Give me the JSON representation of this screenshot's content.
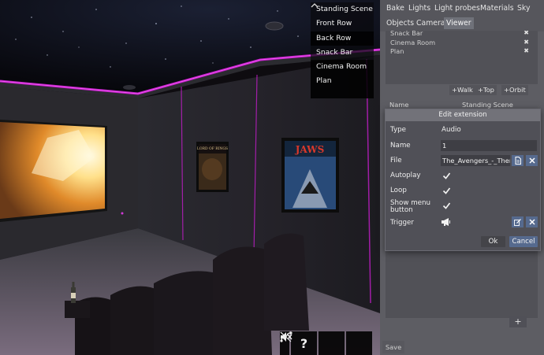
{
  "scene": {
    "camera_menu": [
      "Standing Scene",
      "Front Row",
      "Back Row",
      "Snack Bar",
      "Cinema Room",
      "Plan"
    ],
    "collapse_icon": "chevron-up-icon",
    "posters": [
      "THE LORD OF THE RINGS",
      "JAWS"
    ],
    "toolbar": {
      "expand_icon": "chevron-right-icon",
      "help_label": "?",
      "mute_icon": "speaker-muted-icon",
      "path_icon": "curve-path-icon"
    },
    "accent_color": "#c21ec9"
  },
  "panel": {
    "tabs": [
      "Bake",
      "Lights",
      "Light probes",
      "Materials",
      "Sky",
      "Objects",
      "Camera",
      "Viewer"
    ],
    "active_tab": "Viewer",
    "list_items": [
      "Snack Bar",
      "Cinema Room",
      "Plan"
    ],
    "actions": {
      "walk": "+Walk",
      "top": "+Top",
      "orbit": "+Orbit"
    },
    "table_headers": {
      "name": "Name",
      "camera": "Standing Scene"
    },
    "add_label": "+",
    "save_label": "Save"
  },
  "dialog": {
    "title": "Edit extension",
    "type_label": "Type",
    "type_value": "Audio",
    "name_label": "Name",
    "name_value": "1",
    "file_label": "File",
    "file_value": "The_Avengers_-_Theme",
    "autoplay_label": "Autoplay",
    "loop_label": "Loop",
    "show_menu_label_1": "Show menu",
    "show_menu_label_2": "button",
    "trigger_label": "Trigger",
    "ok_label": "Ok",
    "cancel_label": "Cancel",
    "accent_color": "#566a8e"
  }
}
